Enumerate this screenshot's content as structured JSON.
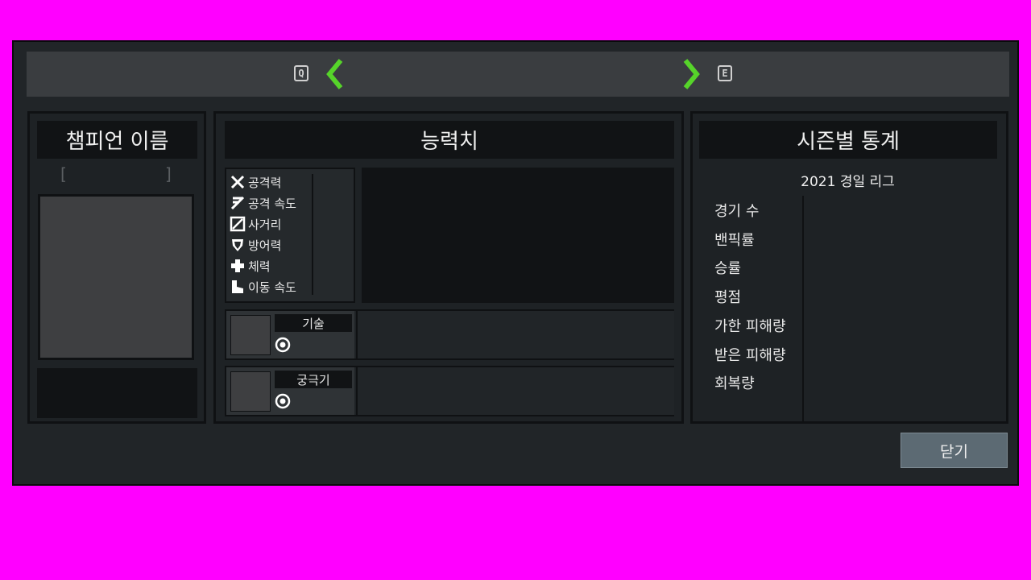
{
  "nav": {
    "prev_key": "Q",
    "next_key": "E",
    "arrow_color": "#56d42a"
  },
  "champion": {
    "header": "챔피언 이름",
    "bracket_left": "[",
    "bracket_right": "]"
  },
  "stats": {
    "header": "능력치",
    "items": [
      {
        "icon": "sword-icon",
        "label": "공격력"
      },
      {
        "icon": "attack-speed-icon",
        "label": "공격 속도"
      },
      {
        "icon": "range-icon",
        "label": "사거리"
      },
      {
        "icon": "shield-icon",
        "label": "방어력"
      },
      {
        "icon": "cross-icon",
        "label": "체력"
      },
      {
        "icon": "boot-icon",
        "label": "이동 속도"
      }
    ]
  },
  "skills": [
    {
      "label": "기술",
      "icon": "target-icon"
    },
    {
      "label": "궁극기",
      "icon": "target-icon"
    }
  ],
  "season": {
    "header": "시즌별 통계",
    "title": "2021 경일 리그",
    "rows": [
      "경기 수",
      "밴픽률",
      "승률",
      "평점",
      "가한 피해량",
      "받은 피해량",
      "회복량"
    ]
  },
  "close_label": "닫기"
}
